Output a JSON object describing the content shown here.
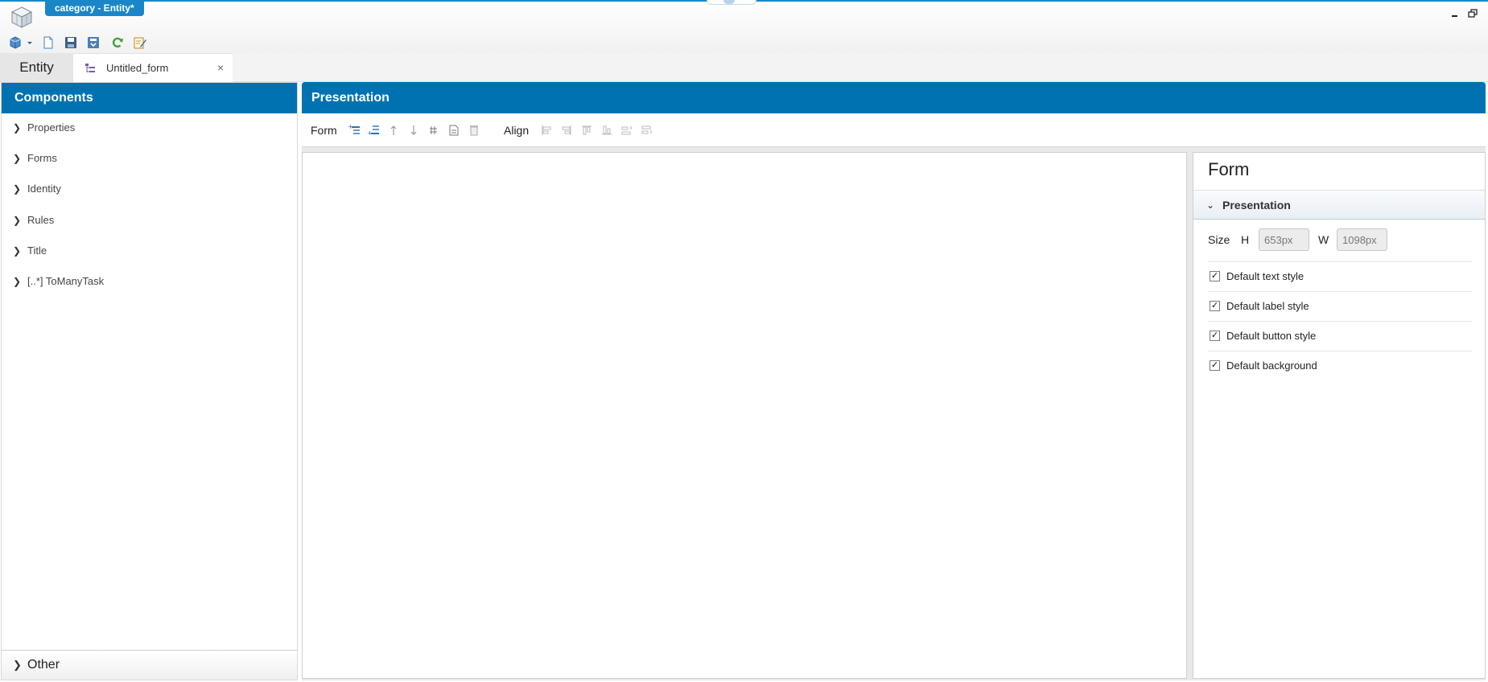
{
  "window": {
    "title": "category - Entity*",
    "minimize_icon": "minimize-icon",
    "restore_icon": "restore-icon"
  },
  "toolbar": {
    "icons": [
      "back-icon",
      "dropdown-arrow-icon",
      "new-document-icon",
      "save-icon",
      "save-all-icon",
      "refresh-icon",
      "edit-icon"
    ]
  },
  "tabs": {
    "entity": "Entity",
    "untitled_form": "Untitled_form",
    "close": "×"
  },
  "components": {
    "header": "Components",
    "items": [
      {
        "label": "Properties"
      },
      {
        "label": "Forms"
      },
      {
        "label": "Identity"
      },
      {
        "label": "Rules"
      },
      {
        "label": "Title"
      },
      {
        "label": "[..*] ToManyTask"
      }
    ],
    "other": "Other"
  },
  "presentation": {
    "header": "Presentation",
    "form_label": "Form",
    "align_label": "Align",
    "form_icons": [
      "add-field-icon",
      "add-group-icon",
      "move-up-icon",
      "move-down-icon",
      "grid-icon",
      "document-icon",
      "delete-icon"
    ],
    "align_icons": [
      "align-left-icon",
      "align-right-icon",
      "align-top-icon",
      "align-bottom-icon",
      "distribute-horizontal-icon",
      "distribute-vertical-icon"
    ]
  },
  "properties": {
    "title": "Form",
    "section": "Presentation",
    "size_label": "Size",
    "height_label": "H",
    "height_value": "653px",
    "width_label": "W",
    "width_value": "1098px",
    "checkboxes": [
      {
        "label": "Default text style",
        "checked": true
      },
      {
        "label": "Default label style",
        "checked": true
      },
      {
        "label": "Default button style",
        "checked": true
      },
      {
        "label": "Default background",
        "checked": true
      }
    ]
  },
  "colors": {
    "accent": "#0072b1",
    "title_tab": "#1a86c8"
  }
}
